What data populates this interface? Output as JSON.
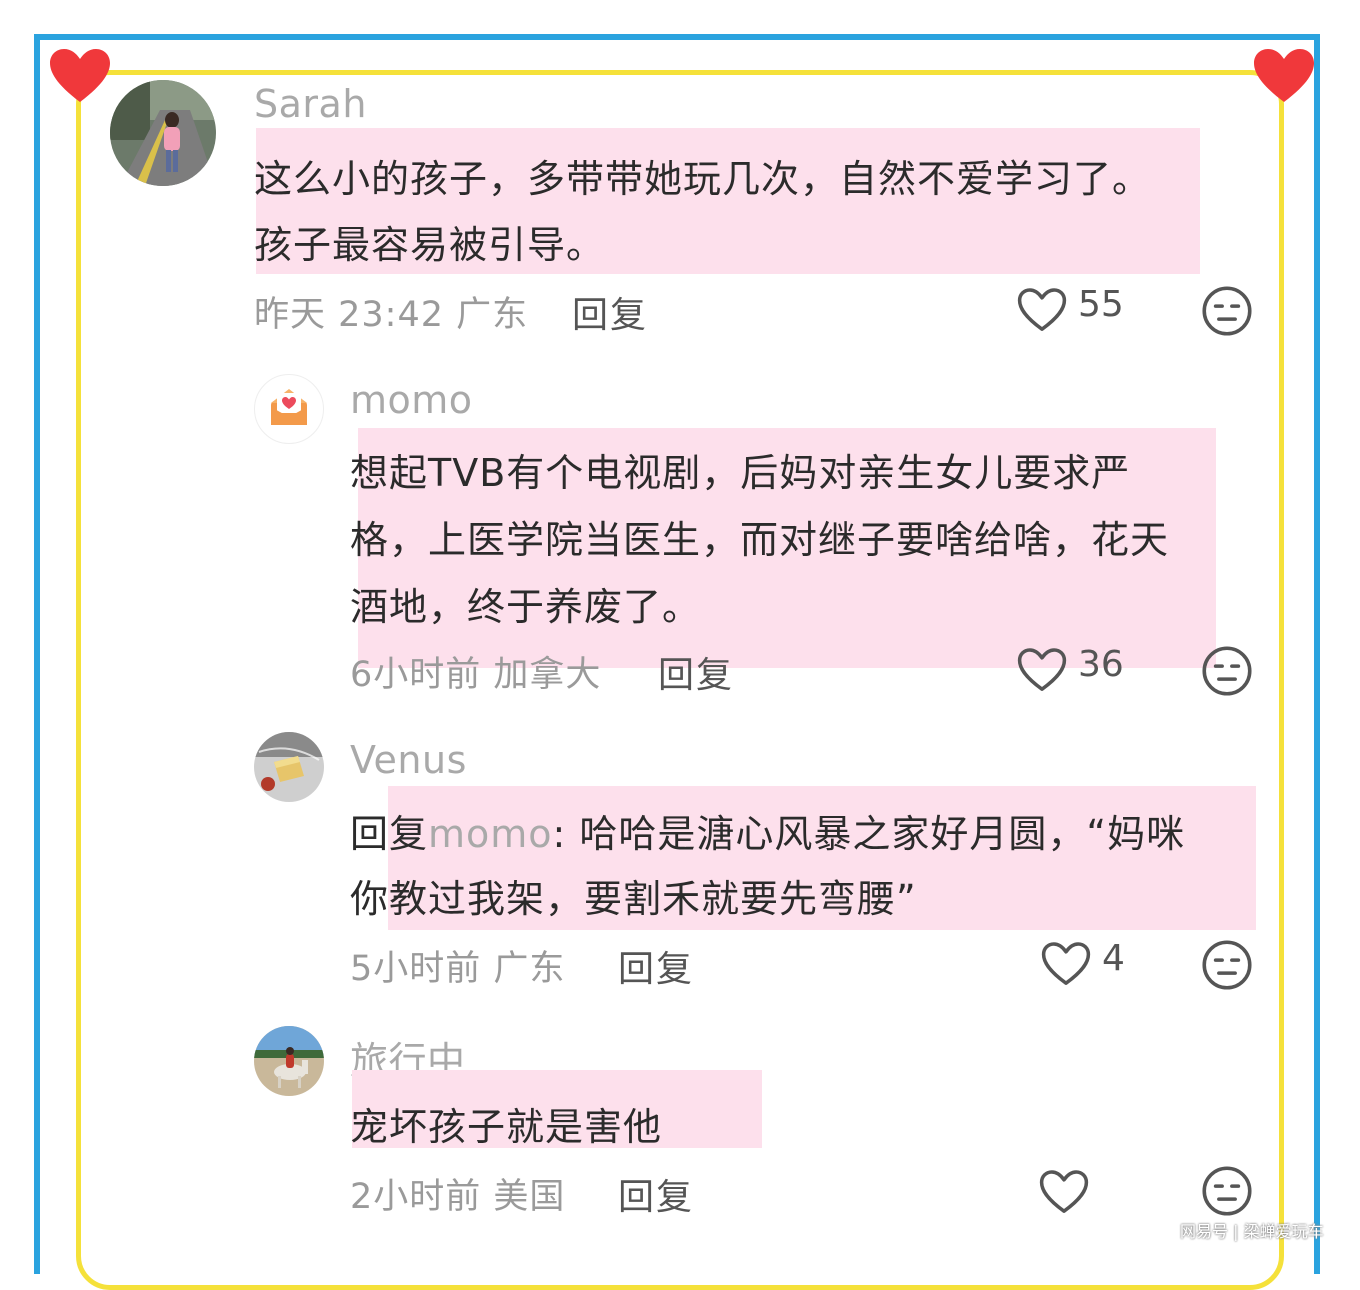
{
  "colors": {
    "frame_blue": "#2aa3df",
    "frame_yellow": "#f5e13a",
    "heart_red": "#f0383b",
    "highlight_pink": "#fde0ec",
    "username_gray": "#a9a9a9"
  },
  "comments": [
    {
      "username": "Sarah",
      "avatar_icon": "girl-on-road-photo",
      "text_lines": [
        "这么小的孩子，多带带她玩几次，自然不爱学习了。",
        "孩子最容易被引导。"
      ],
      "meta": "昨天 23:42 广东",
      "reply_label": "回复",
      "likes": "55"
    },
    {
      "username": "momo",
      "avatar_icon": "heart-envelope-icon",
      "text_lines": [
        "想起TVB有个电视剧，后妈对亲生女儿要求严",
        "格，上医学院当医生，而对继子要啥给啥，花天",
        "酒地，终于养废了。"
      ],
      "meta": "6小时前 加拿大",
      "reply_label": "回复",
      "likes": "36"
    },
    {
      "username": "Venus",
      "avatar_icon": "food-photo",
      "reply_prefix": "回复",
      "reply_to": "momo",
      "first_line_rest": ": 哈哈是溏心风暴之家好月圆，“妈咪",
      "text_lines": [
        "你教过我架，要割禾就要先弯腰”"
      ],
      "meta": "5小时前 广东",
      "reply_label": "回复",
      "likes": "4"
    },
    {
      "username": "旅行中",
      "avatar_icon": "horse-riding-photo",
      "text_lines": [
        "宠坏孩子就是害他"
      ],
      "meta": "2小时前 美国",
      "reply_label": "回复",
      "likes": ""
    }
  ],
  "watermark": "网易号 | 梁蝉爱玩车"
}
